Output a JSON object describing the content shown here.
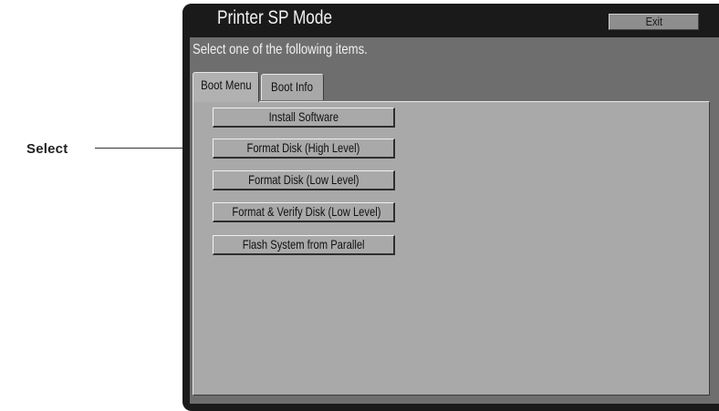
{
  "callout": {
    "label": "Select"
  },
  "window": {
    "title": "Printer SP Mode",
    "exit_label": "Exit",
    "instruction": "Select one of the following items."
  },
  "tabs": [
    {
      "label": "Boot Menu",
      "active": true
    },
    {
      "label": "Boot Info",
      "active": false
    }
  ],
  "menu": {
    "items": [
      {
        "label": "Install Software"
      },
      {
        "label": "Format Disk (High Level)"
      },
      {
        "label": "Format Disk (Low Level)"
      },
      {
        "label": "Format & Verify Disk (Low Level)"
      },
      {
        "label": "Flash System from Parallel"
      }
    ]
  },
  "colors": {
    "frame": "#1a1a1a",
    "body": "#6e6e6e",
    "content": "#a9a9a9",
    "exit_button": "#8e8e8e"
  }
}
